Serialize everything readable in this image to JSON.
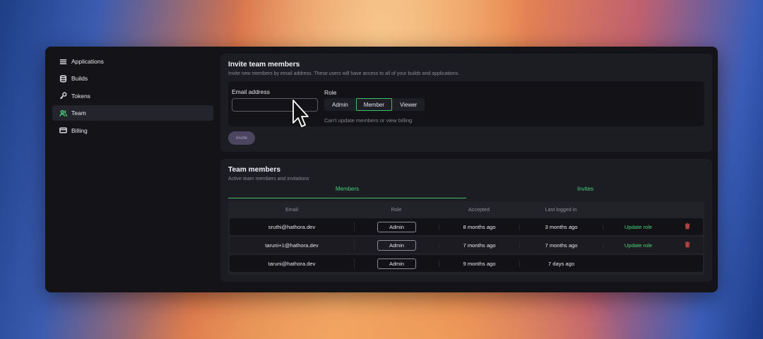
{
  "sidebar": {
    "items": [
      {
        "label": "Applications",
        "icon": "list-icon",
        "active": false
      },
      {
        "label": "Builds",
        "icon": "database-icon",
        "active": false
      },
      {
        "label": "Tokens",
        "icon": "key-icon",
        "active": false
      },
      {
        "label": "Team",
        "icon": "users-icon",
        "active": true
      },
      {
        "label": "Billing",
        "icon": "credit-card-icon",
        "active": false
      }
    ]
  },
  "invite": {
    "title": "Invite team members",
    "subtitle": "Invite new members by email address. These users will have access to all of your builds and applications.",
    "email_label": "Email address",
    "email_value": "",
    "role_label": "Role",
    "roles": [
      "Admin",
      "Member",
      "Viewer"
    ],
    "selected_role": "Member",
    "role_hint": "Can't update members or view billing",
    "invite_button": "Invite"
  },
  "team": {
    "title": "Team members",
    "subtitle": "Active team members and invitations",
    "tabs": [
      {
        "label": "Members",
        "active": true
      },
      {
        "label": "Invites",
        "active": false
      }
    ],
    "columns": [
      "Email",
      "Role",
      "Accepted",
      "Last logged in"
    ],
    "rows": [
      {
        "email": "sruthi@hathora.dev",
        "role": "Admin",
        "accepted": "8 months ago",
        "last_login": "3 months ago",
        "action": "Update role",
        "deletable": true
      },
      {
        "email": "taruni+1@hathora.dev",
        "role": "Admin",
        "accepted": "7 months ago",
        "last_login": "7 months ago",
        "action": "Update role",
        "deletable": true
      },
      {
        "email": "taruni@hathora.dev",
        "role": "Admin",
        "accepted": "9 months ago",
        "last_login": "7 days ago",
        "action": "",
        "deletable": false
      }
    ]
  },
  "colors": {
    "accent": "#4ad07a",
    "danger": "#b0443c",
    "window_bg": "#131318",
    "card_bg": "#1c1c23"
  }
}
